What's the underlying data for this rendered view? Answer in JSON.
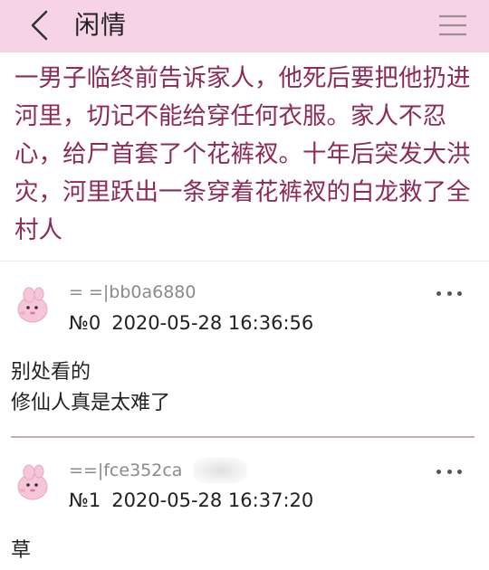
{
  "header": {
    "title": "闲情",
    "back_icon": "chevron-left-icon",
    "menu_icon": "hamburger-menu-icon",
    "background_color": "#f7d3e6"
  },
  "post": {
    "body": "一男子临终前告诉家人，他死后要把他扔进河里，切记不能给穿任何衣服。家人不忍心，给尸首套了个花裤衩。十年后突发大洪灾，河里跃出一条穿着花裤衩的白龙救了全村人",
    "text_color": "#8e2a57"
  },
  "replies": [
    {
      "author": "= =|bb0a6880",
      "number": "№0",
      "timestamp": "2020-05-28 16:36:56",
      "lines": [
        "别处看的",
        "修仙人真是太难了"
      ]
    },
    {
      "author": "==|fce352ca",
      "number": "№1",
      "timestamp": "2020-05-28 16:37:20",
      "lines": [
        "草"
      ]
    }
  ],
  "more_icon": "more-dots-icon",
  "avatar_icon": "pink-mascot-avatar-icon"
}
